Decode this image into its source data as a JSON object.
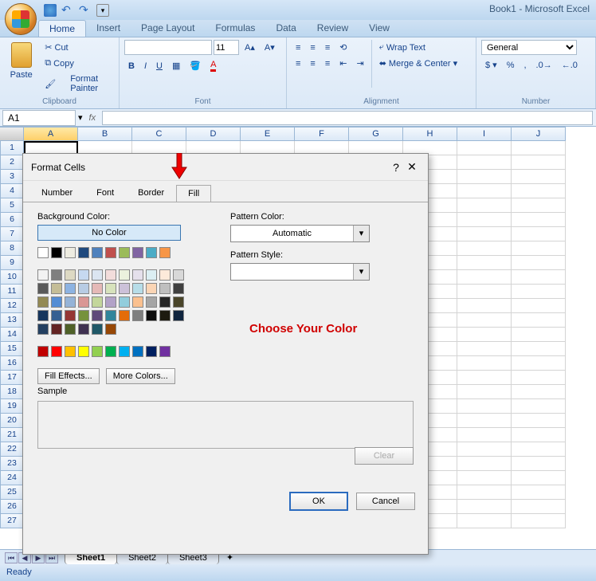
{
  "window": {
    "title": "Book1 - Microsoft Excel"
  },
  "qat": {
    "save": "save-icon",
    "undo": "undo-icon",
    "redo": "redo-icon",
    "more": "more-icon"
  },
  "tabs": [
    "Home",
    "Insert",
    "Page Layout",
    "Formulas",
    "Data",
    "Review",
    "View"
  ],
  "active_tab": "Home",
  "ribbon": {
    "clipboard": {
      "label": "Clipboard",
      "paste": "Paste",
      "cut": "Cut",
      "copy": "Copy",
      "fp": "Format Painter"
    },
    "font": {
      "label": "Font",
      "name_value": "",
      "size_value": "11",
      "bold": "B",
      "italic": "I",
      "underline": "U"
    },
    "alignment": {
      "label": "Alignment",
      "wrap": "Wrap Text",
      "merge": "Merge & Center"
    },
    "number": {
      "label": "Number",
      "format": "General"
    }
  },
  "formula": {
    "cell": "A1",
    "fx": "fx",
    "value": ""
  },
  "columns": [
    "A",
    "B",
    "C",
    "D",
    "E",
    "F",
    "G",
    "H",
    "I",
    "J"
  ],
  "rows_count": 27,
  "sheets": {
    "names": [
      "Sheet1",
      "Sheet2",
      "Sheet3"
    ],
    "active": "Sheet1"
  },
  "status": "Ready",
  "dialog": {
    "title": "Format Cells",
    "tabs": [
      "Number",
      "Font",
      "Border",
      "Fill"
    ],
    "active_tab": "Fill",
    "bg_label": "Background Color:",
    "nocolor": "No Color",
    "fill_effects": "Fill Effects...",
    "more_colors": "More Colors...",
    "pattern_color_label": "Pattern Color:",
    "pattern_color_value": "Automatic",
    "pattern_style_label": "Pattern Style:",
    "pattern_style_value": "",
    "sample": "Sample",
    "clear": "Clear",
    "ok": "OK",
    "cancel": "Cancel",
    "annotation": "Choose Your Color",
    "palette_row1": [
      "#ffffff",
      "#000000",
      "#eeece1",
      "#1f497d",
      "#4f81bd",
      "#c0504d",
      "#9bbb59",
      "#8064a2",
      "#4bacc6",
      "#f79646"
    ],
    "palette_shades": [
      [
        "#f2f2f2",
        "#7f7f7f",
        "#ddd9c3",
        "#c6d9f0",
        "#dbe5f1",
        "#f2dcdb",
        "#ebf1dd",
        "#e5e0ec",
        "#dbeef3",
        "#fdeada"
      ],
      [
        "#d8d8d8",
        "#595959",
        "#c4bd97",
        "#8db3e2",
        "#b8cce4",
        "#e5b9b7",
        "#d7e3bc",
        "#ccc1d9",
        "#b7dde8",
        "#fbd5b5"
      ],
      [
        "#bfbfbf",
        "#3f3f3f",
        "#938953",
        "#548dd4",
        "#95b3d7",
        "#d99694",
        "#c3d69b",
        "#b2a2c7",
        "#92cddc",
        "#fac08f"
      ],
      [
        "#a5a5a5",
        "#262626",
        "#494429",
        "#17365d",
        "#366092",
        "#953734",
        "#76923c",
        "#5f497a",
        "#31859b",
        "#e36c09"
      ],
      [
        "#7f7f7f",
        "#0c0c0c",
        "#1d1b10",
        "#0f243e",
        "#244061",
        "#632423",
        "#4f6128",
        "#3f3151",
        "#205867",
        "#974806"
      ]
    ],
    "palette_standard": [
      "#c00000",
      "#ff0000",
      "#ffc000",
      "#ffff00",
      "#92d050",
      "#00b050",
      "#00b0f0",
      "#0070c0",
      "#002060",
      "#7030a0"
    ]
  }
}
